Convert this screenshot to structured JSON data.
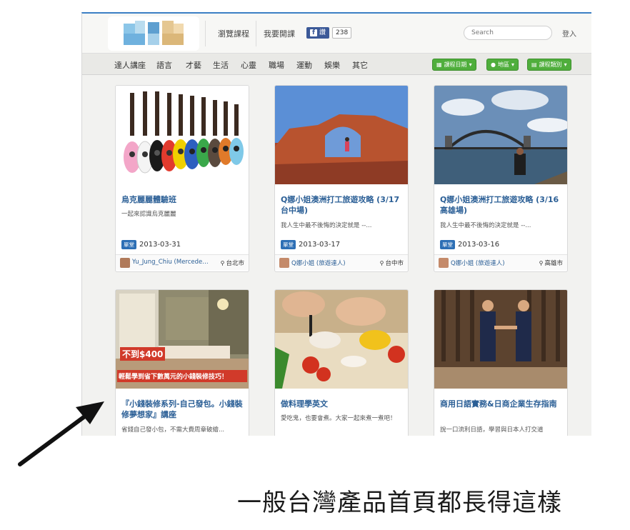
{
  "header": {
    "nav_links": [
      "瀏覽課程",
      "我要開課"
    ],
    "fb_like": "讚",
    "fb_count": "238",
    "search_placeholder": "Search",
    "login": "登入"
  },
  "categories": [
    "達人講座",
    "語言",
    "才藝",
    "生活",
    "心靈",
    "職場",
    "運動",
    "娛樂",
    "其它"
  ],
  "filters": [
    "課程日期",
    "地區",
    "課程類別"
  ],
  "cards": [
    {
      "title": "烏克麗麗體驗班",
      "desc": "一起來認識烏克麗麗",
      "badge": "單堂",
      "date": "2013-03-31",
      "author": "Yu_Jung_Chiu (Mercedes ...",
      "location": "台北市"
    },
    {
      "title": "Q娜小姐澳洲打工旅遊攻略 (3/17台中場)",
      "desc": "我人生中最不後悔的決定就是 --...",
      "badge": "單堂",
      "date": "2013-03-17",
      "author": "Q娜小姐 (旅遊達人)",
      "location": "台中市"
    },
    {
      "title": "Q娜小姐澳洲打工旅遊攻略 (3/16高雄場)",
      "desc": "我人生中最不後悔的決定就是 --...",
      "badge": "單堂",
      "date": "2013-03-16",
      "author": "Q娜小姐 (旅遊達人)",
      "location": "高雄市"
    },
    {
      "title": "『小錢裝修系列-自己發包。小錢裝修夢想家』講座",
      "desc": "省錢自己發小包，不需大費周章破繪...",
      "image_text_1": "不到$400",
      "image_text_2": "輕鬆學到省下數萬元的小錢裝修技巧！"
    },
    {
      "title": "做料理學英文",
      "desc": "愛吃鬼，也要會煮。大家一起來煮一煮吧！"
    },
    {
      "title": "商用日語實務&日商企業生存指南",
      "desc": "說一口流利日語，學習與日本人打交道"
    }
  ],
  "caption": "一般台灣產品首頁都長得這樣",
  "colors": {
    "accent": "#2b5f96",
    "filter_green": "#4fae3c",
    "badge_blue": "#2d6fb5",
    "fb_blue": "#3b5998"
  }
}
